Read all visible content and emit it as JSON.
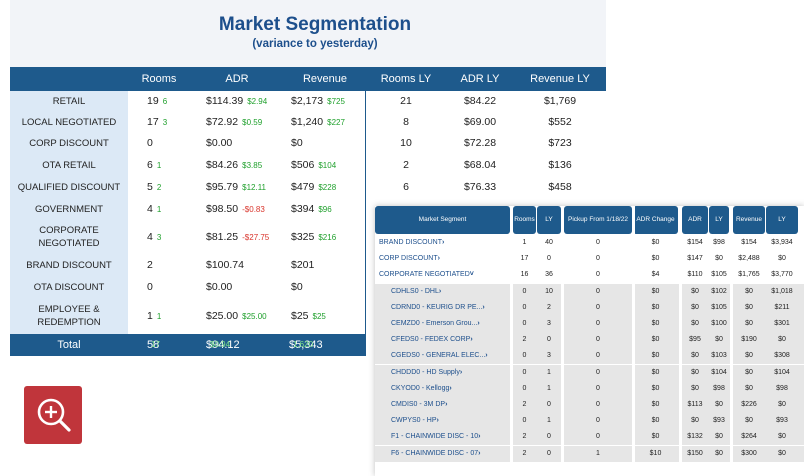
{
  "title": "Market Segmentation",
  "subtitle": "(variance to yesterday)",
  "table": {
    "headers": [
      "Rooms",
      "ADR",
      "Revenue",
      "Rooms LY",
      "ADR LY",
      "Revenue LY"
    ],
    "rows": [
      {
        "label": "RETAIL",
        "rooms": "19",
        "rooms_var": "6",
        "adr": "$114.39",
        "adr_var": "$2.94",
        "rev": "$2,173",
        "rev_var": "$725",
        "rooms_ly": "21",
        "adr_ly": "$84.22",
        "rev_ly": "$1,769"
      },
      {
        "label": "LOCAL NEGOTIATED",
        "rooms": "17",
        "rooms_var": "3",
        "adr": "$72.92",
        "adr_var": "$0.59",
        "rev": "$1,240",
        "rev_var": "$227",
        "rooms_ly": "8",
        "adr_ly": "$69.00",
        "rev_ly": "$552"
      },
      {
        "label": "CORP DISCOUNT",
        "rooms": "0",
        "rooms_var": "",
        "adr": "$0.00",
        "adr_var": "",
        "rev": "$0",
        "rev_var": "",
        "rooms_ly": "10",
        "adr_ly": "$72.28",
        "rev_ly": "$723"
      },
      {
        "label": "OTA RETAIL",
        "rooms": "6",
        "rooms_var": "1",
        "adr": "$84.26",
        "adr_var": "$3.85",
        "rev": "$506",
        "rev_var": "$104",
        "rooms_ly": "2",
        "adr_ly": "$68.04",
        "rev_ly": "$136"
      },
      {
        "label": "QUALIFIED DISCOUNT",
        "rooms": "5",
        "rooms_var": "2",
        "adr": "$95.79",
        "adr_var": "$12.11",
        "rev": "$479",
        "rev_var": "$228",
        "rooms_ly": "6",
        "adr_ly": "$76.33",
        "rev_ly": "$458"
      },
      {
        "label": "GOVERNMENT",
        "rooms": "4",
        "rooms_var": "1",
        "adr": "$98.50",
        "adr_var": "-$0.83",
        "rev": "$394",
        "rev_var": "$96",
        "rooms_ly": "",
        "adr_ly": "",
        "rev_ly": ""
      },
      {
        "label": "CORPORATE NEGOTIATED",
        "rooms": "4",
        "rooms_var": "3",
        "adr": "$81.25",
        "adr_var": "-$27.75",
        "rev": "$325",
        "rev_var": "$216",
        "rooms_ly": "",
        "adr_ly": "",
        "rev_ly": ""
      },
      {
        "label": "BRAND DISCOUNT",
        "rooms": "2",
        "rooms_var": "",
        "adr": "$100.74",
        "adr_var": "",
        "rev": "$201",
        "rev_var": "",
        "rooms_ly": "",
        "adr_ly": "",
        "rev_ly": ""
      },
      {
        "label": "OTA DISCOUNT",
        "rooms": "0",
        "rooms_var": "",
        "adr": "$0.00",
        "adr_var": "",
        "rev": "$0",
        "rev_var": "",
        "rooms_ly": "",
        "adr_ly": "",
        "rev_ly": ""
      },
      {
        "label": "EMPLOYEE & REDEMPTION",
        "rooms": "1",
        "rooms_var": "1",
        "adr": "$25.00",
        "adr_var": "$25.00",
        "rev": "$25",
        "rev_var": "$25",
        "rooms_ly": "",
        "adr_ly": "",
        "rev_ly": ""
      }
    ],
    "total": {
      "label": "Total",
      "rooms": "58",
      "rooms_var": "17",
      "adr": "$94.12",
      "adr_var": "$0.94",
      "rev": "$5,343",
      "rev_var": "1,620"
    }
  },
  "overlay": {
    "headers": [
      "Market Segment",
      "Rooms",
      "LY",
      "Pickup From 1/18/22",
      "ADR Change",
      "ADR",
      "LY",
      "Revenue",
      "LY"
    ],
    "rows": [
      {
        "seg": "BRAND DISCOUNT",
        "chev": "›",
        "sub": false,
        "v": [
          "1",
          "40",
          "0",
          "$0",
          "$154",
          "$98",
          "$154",
          "$3,934"
        ]
      },
      {
        "seg": "CORP DISCOUNT",
        "chev": "›",
        "sub": false,
        "v": [
          "17",
          "0",
          "0",
          "$0",
          "$147",
          "$0",
          "$2,488",
          "$0"
        ]
      },
      {
        "seg": "CORPORATE NEGOTIATED",
        "chev": "˅",
        "sub": false,
        "v": [
          "16",
          "36",
          "0",
          "$4",
          "$110",
          "$105",
          "$1,765",
          "$3,770"
        ]
      },
      {
        "seg": "CDHLS0 - DHL",
        "chev": "›",
        "sub": true,
        "v": [
          "0",
          "10",
          "0",
          "$0",
          "$0",
          "$102",
          "$0",
          "$1,018"
        ]
      },
      {
        "seg": "CDRND0 - KEURIG DR PE...",
        "chev": "›",
        "sub": true,
        "v": [
          "0",
          "2",
          "0",
          "$0",
          "$0",
          "$105",
          "$0",
          "$211"
        ]
      },
      {
        "seg": "CEMZD0 - Emerson Grou...",
        "chev": "›",
        "sub": true,
        "v": [
          "0",
          "3",
          "0",
          "$0",
          "$0",
          "$100",
          "$0",
          "$301"
        ]
      },
      {
        "seg": "CFEDS0 - FEDEX CORP",
        "chev": "›",
        "sub": true,
        "v": [
          "2",
          "0",
          "0",
          "$0",
          "$95",
          "$0",
          "$190",
          "$0"
        ]
      },
      {
        "seg": "CGEDS0 - GENERAL ELEC...",
        "chev": "›",
        "sub": true,
        "v": [
          "0",
          "3",
          "0",
          "$0",
          "$0",
          "$103",
          "$0",
          "$308"
        ]
      },
      {
        "seg": "CHDDD0 - HD Supply",
        "chev": "›",
        "sub": true,
        "v": [
          "0",
          "1",
          "0",
          "$0",
          "$0",
          "$104",
          "$0",
          "$104"
        ]
      },
      {
        "seg": "CKYOD0 - Kellogg",
        "chev": "›",
        "sub": true,
        "v": [
          "0",
          "1",
          "0",
          "$0",
          "$0",
          "$98",
          "$0",
          "$98"
        ]
      },
      {
        "seg": "CMDIS0 - 3M DP",
        "chev": "›",
        "sub": true,
        "v": [
          "2",
          "0",
          "0",
          "$0",
          "$113",
          "$0",
          "$226",
          "$0"
        ]
      },
      {
        "seg": "CWPYS0 - HP",
        "chev": "›",
        "sub": true,
        "v": [
          "0",
          "1",
          "0",
          "$0",
          "$0",
          "$93",
          "$0",
          "$93"
        ]
      },
      {
        "seg": "F1 - CHAINWIDE DISC - 10",
        "chev": "›",
        "sub": true,
        "v": [
          "2",
          "0",
          "0",
          "$0",
          "$132",
          "$0",
          "$264",
          "$0"
        ]
      },
      {
        "seg": "F6 - CHAINWIDE DISC - 07",
        "chev": "›",
        "sub": true,
        "v": [
          "2",
          "0",
          "1",
          "$10",
          "$150",
          "$0",
          "$300",
          "$0"
        ]
      }
    ]
  },
  "icons": {
    "zoom": "zoom-in-icon"
  },
  "colors": {
    "header": "#1e5a8c",
    "accent_red": "#c0353b",
    "positive": "#1fa02c",
    "negative": "#d9342b"
  }
}
